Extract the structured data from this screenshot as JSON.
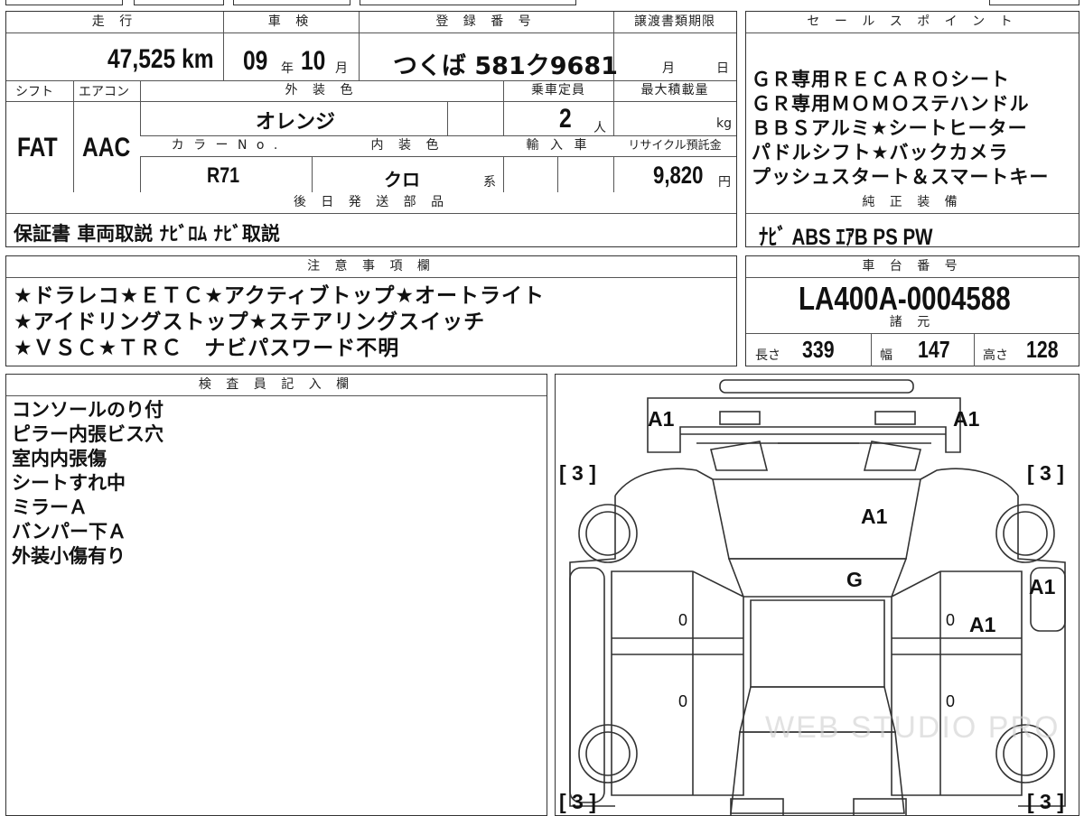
{
  "vehicle": {
    "mileage_label": "走 行",
    "mileage": "47,525 km",
    "inspection_label": "車 検",
    "insp_year": "09",
    "year_unit": "年",
    "insp_month": "10",
    "month_unit": "月",
    "registration_label": "登 録 番 号",
    "registration": "つくば 581ク9681",
    "transfer_deadline_label": "譲渡書類期限",
    "deadline_month_unit": "月",
    "deadline_day_unit": "日",
    "shift_label": "シフト",
    "shift": "FAT",
    "ac_label": "エアコン",
    "ac": "AAC",
    "exterior_color_label": "外 装 色",
    "exterior_color": "オレンジ",
    "capacity_label": "乗車定員",
    "capacity": "2",
    "capacity_unit": "人",
    "max_load_label": "最大積載量",
    "max_load_unit": "kg",
    "color_no_label": "カ ラ ー N o .",
    "color_no": "R71",
    "interior_color_label": "内 装 色",
    "interior_color": "クロ",
    "interior_suffix": "系",
    "import_label": "輸 入 車",
    "recycle_label": "リサイクル預託金",
    "recycle_fee": "9,820",
    "recycle_unit": "円"
  },
  "sales_points": {
    "label": "セ ー ル ス ポ イ ン ト",
    "items": [
      "ＧＲ専用ＲＥＣＡＲＯシート",
      "ＧＲ専用ＭＯＭＯステハンドル",
      "ＢＢＳアルミ★シートヒーター",
      "パドルシフト★バックカメラ",
      "プッシュスタート＆スマートキー"
    ]
  },
  "later_parts": {
    "label": "後 日 発 送 部 品",
    "value": "保証書 車両取説 ﾅﾋﾞﾛﾑ ﾅﾋﾞ取説"
  },
  "factory_equipment": {
    "label": "純 正 装 備",
    "value": "ﾅﾋﾞ ABS ｴｱB PS PW"
  },
  "notes": {
    "label": "注 意 事 項 欄",
    "lines": [
      "★ドラレコ★ＥＴＣ★アクティブトップ★オートライト",
      "★アイドリングストップ★ステアリングスイッチ",
      "★ＶＳＣ★ＴＲＣ　ナビパスワード不明"
    ]
  },
  "chassis": {
    "label": "車 台 番 号",
    "value": "LA400A-0004588"
  },
  "specs": {
    "label": "諸 元",
    "length_label": "長さ",
    "length": "339",
    "width_label": "幅",
    "width": "147",
    "height_label": "高さ",
    "height": "128"
  },
  "inspector": {
    "label": "検 査 員 記 入 欄",
    "lines": [
      "コンソールのり付",
      "ピラー内張ビス穴",
      "室内内張傷",
      "シートすれ中",
      "ミラーＡ",
      "バンパー下Ａ",
      "外装小傷有り"
    ]
  },
  "diagram_marks": {
    "a1_front_left": "A1",
    "a1_front_right": "A1",
    "a1_hood": "A1",
    "g_windshield": "G",
    "a1_right_fender": "A1",
    "a1_right_door": "A1",
    "bracket_tl": "[ 3 ]",
    "bracket_tr": "[ 3 ]",
    "bracket_bl": "[ 3 ]",
    "bracket_br": "[ 3 ]",
    "door_zero": "0",
    "watermark": "WEB STUDIO PRO"
  }
}
